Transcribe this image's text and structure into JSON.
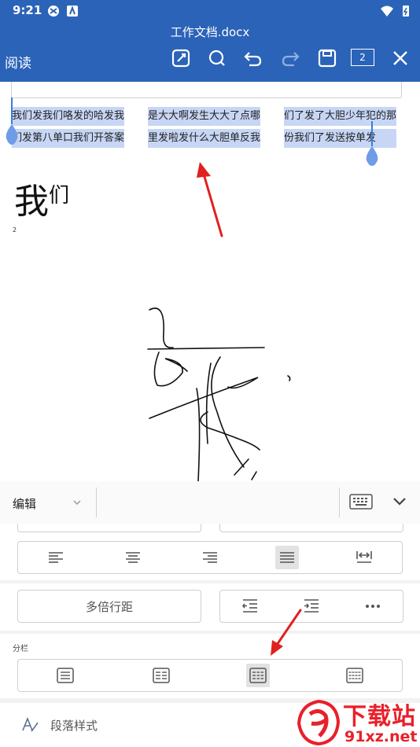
{
  "status": {
    "time": "9:21"
  },
  "header": {
    "doc_title": "工作文档.docx",
    "mode_label": "阅读",
    "page_count": "2"
  },
  "document": {
    "columns": [
      {
        "lines": [
          "我们发我们咯发的哈发我",
          "们发第八单口我们开答案"
        ]
      },
      {
        "lines": [
          "是大大啊发生大大了点哪",
          "里发啦发什么大胆单反我"
        ]
      },
      {
        "lines": [
          "们了发了大胆少年犯的那",
          "份我们了发送按单发"
        ]
      }
    ],
    "big_text_main": "我",
    "big_text_sup": "们",
    "small_text": "2"
  },
  "panel": {
    "edit_label": "编辑",
    "line_spacing_label": "多倍行距",
    "columns_section_label": "分栏",
    "paragraph_style_label": "段落样式"
  },
  "watermark": {
    "text_top": "下载站",
    "text_bottom": "91xz.net"
  },
  "colors": {
    "accent": "#2b63b8",
    "selection": "#c7d6f5",
    "arrow": "#e02020",
    "watermark": "#e8202a"
  }
}
